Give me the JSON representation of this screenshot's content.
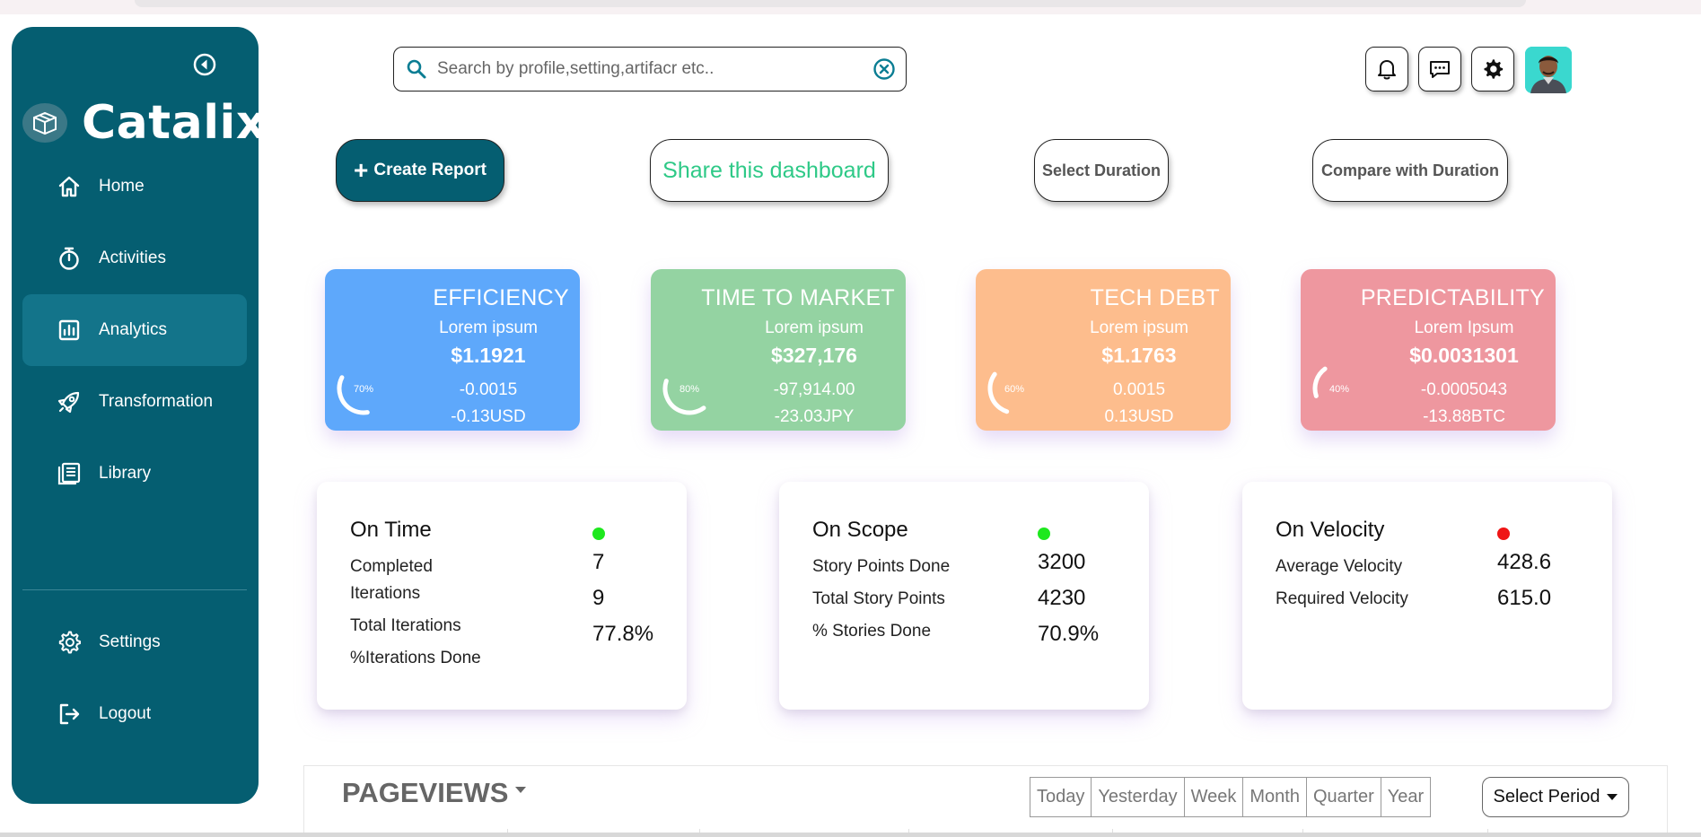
{
  "sidebar": {
    "brand": "Catalix",
    "nav": [
      {
        "label": "Home",
        "icon": "home-icon"
      },
      {
        "label": "Activities",
        "icon": "stopwatch-icon"
      },
      {
        "label": "Analytics",
        "icon": "chart-icon",
        "active": true
      },
      {
        "label": "Transformation",
        "icon": "rocket-icon"
      },
      {
        "label": "Library",
        "icon": "book-icon"
      }
    ],
    "bottom_nav": [
      {
        "label": "Settings",
        "icon": "gear-icon"
      },
      {
        "label": "Logout",
        "icon": "logout-icon"
      }
    ]
  },
  "header": {
    "search_placeholder": "Search by profile,setting,artifacr etc.."
  },
  "actions": {
    "create_report": "Create Report",
    "share": "Share this dashboard",
    "select_duration": "Select Duration",
    "compare": "Compare with Duration"
  },
  "kpis": [
    {
      "title": "EFFICIENCY",
      "sub": "Lorem ipsum",
      "value": "$1.1921",
      "delta": "-0.0015",
      "change": "-0.13USD",
      "gauge_pct": 70,
      "gauge_label": "70%",
      "bg": "#5ea8fb"
    },
    {
      "title": "TIME TO MARKET",
      "sub": "Lorem ipsum",
      "value": "$327,176",
      "delta": "-97,914.00",
      "change": "-23.03JPY",
      "gauge_pct": 80,
      "gauge_label": "80%",
      "bg": "#94d3a2"
    },
    {
      "title": "TECH DEBT",
      "sub": "Lorem ipsum",
      "value": "$1.1763",
      "delta": "0.0015",
      "change": "0.13USD",
      "gauge_pct": 60,
      "gauge_label": "60%",
      "bg": "#fdbd8d"
    },
    {
      "title": "PREDICTABILITY",
      "sub": "Lorem Ipsum",
      "value": "$0.0031301",
      "delta": "-0.0005043",
      "change": "-13.88BTC",
      "gauge_pct": 40,
      "gauge_label": "40%",
      "bg": "#ee979f"
    }
  ],
  "metrics": [
    {
      "title": "On Time",
      "status_color": "#1ee81e",
      "labels": [
        "Completed",
        "Iterations",
        "Total Iterations",
        "%Iterations Done"
      ],
      "values": [
        "7",
        "9",
        "77.8%"
      ]
    },
    {
      "title": "On Scope",
      "status_color": "#1ee81e",
      "labels": [
        "Story Points Done",
        "Total Story Points",
        "% Stories Done"
      ],
      "values": [
        "3200",
        "4230",
        "70.9%"
      ]
    },
    {
      "title": "On Velocity",
      "status_color": "#ef1515",
      "labels": [
        "Average Velocity",
        "Required Velocity"
      ],
      "values": [
        "428.6",
        "615.0"
      ]
    }
  ],
  "pageviews": {
    "title": "PAGEVIEWS",
    "tabs": [
      "Today",
      "Yesterday",
      "Week",
      "Month",
      "Quarter",
      "Year"
    ],
    "select": "Select Period"
  }
}
